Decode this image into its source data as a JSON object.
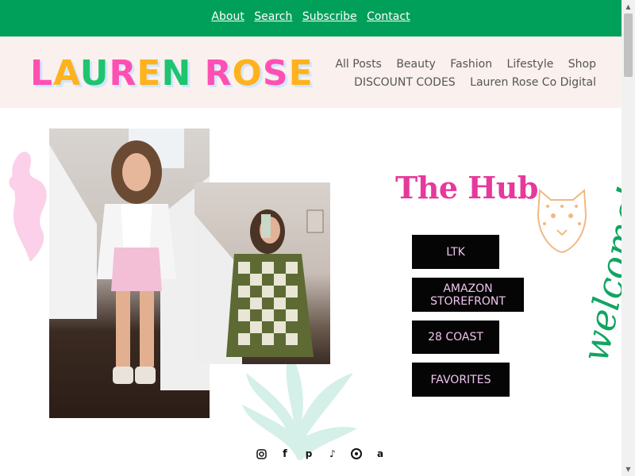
{
  "top_nav": {
    "links": [
      "About",
      "Search",
      "Subscribe",
      "Contact"
    ]
  },
  "header": {
    "logo": {
      "letters": [
        "L",
        "A",
        "U",
        "R",
        "E",
        "N",
        " ",
        "R",
        "O",
        "S",
        "E"
      ],
      "colors": [
        "#ff4fb2",
        "#ffb21c",
        "#1ec46f",
        "#ff4fb2",
        "#ffb21c",
        "#1ec46f",
        "",
        "#ff4fb2",
        "#ffb21c",
        "#ff4fb2",
        "#ffb21c"
      ]
    },
    "nav_row1": [
      "All Posts",
      "Beauty",
      "Fashion",
      "Lifestyle",
      "Shop"
    ],
    "nav_row2": [
      "DISCOUNT CODES",
      "Lauren Rose Co Digital"
    ]
  },
  "hub": {
    "title": "The Hub",
    "title_color": "#e6399b",
    "buttons": [
      "LTK",
      "AMAZON STOREFRONT",
      "28 COAST",
      "FAVORITES"
    ],
    "welcome": "welcome!"
  },
  "social_icons": [
    "instagram-icon",
    "facebook-icon",
    "pinterest-icon",
    "tiktok-icon",
    "ltk-icon",
    "amazon-icon"
  ],
  "colors": {
    "accent_green": "#00a05a",
    "header_bg": "#faf0ee",
    "button_bg": "#050505",
    "button_text": "#f0c4ee"
  }
}
